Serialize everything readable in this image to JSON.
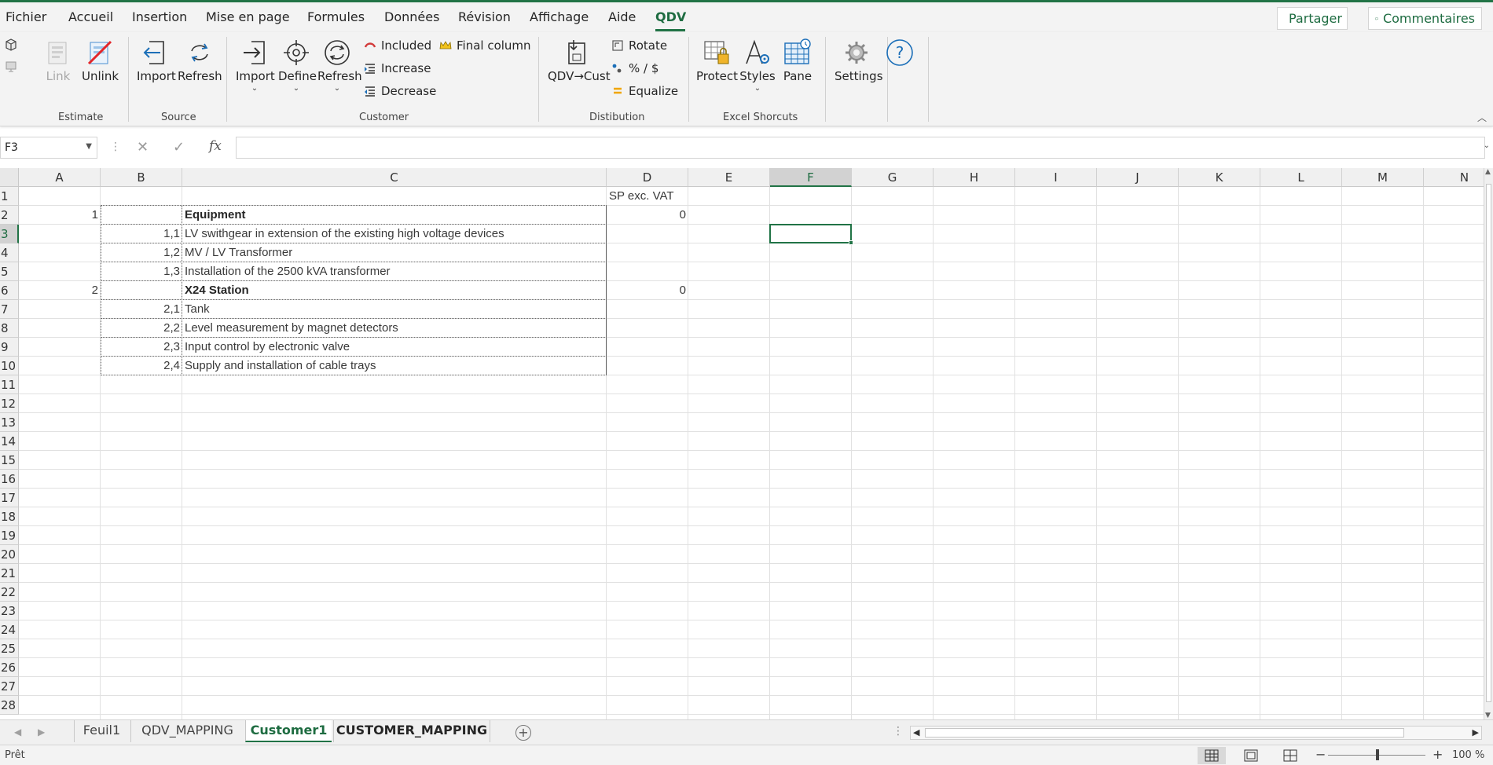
{
  "menu": {
    "items": [
      "Fichier",
      "Accueil",
      "Insertion",
      "Mise en page",
      "Formules",
      "Données",
      "Révision",
      "Affichage",
      "Aide",
      "QDV"
    ],
    "active": "QDV",
    "share_label": "Partager",
    "comments_label": "Commentaires"
  },
  "ribbon": {
    "estimate": {
      "label": "Estimate",
      "link": "Link",
      "unlink": "Unlink"
    },
    "source": {
      "label": "Source",
      "import": "Import",
      "refresh": "Refresh"
    },
    "customer": {
      "label": "Customer",
      "import": "Import",
      "define": "Define",
      "refresh": "Refresh",
      "included": "Included",
      "increase": "Increase",
      "decrease": "Decrease",
      "final_column": "Final column"
    },
    "distibution": {
      "label": "Distibution",
      "qdv_cust": "QDV→Cust",
      "rotate": "Rotate",
      "percent_dollar": "% / $",
      "equalize": "Equalize"
    },
    "excel": {
      "label": "Excel Shorcuts",
      "protect": "Protect",
      "styles": "Styles",
      "pane": "Pane"
    },
    "settings": {
      "label": "Settings"
    }
  },
  "formula_bar": {
    "name_box": "F3",
    "formula": ""
  },
  "columns": [
    "A",
    "B",
    "C",
    "D",
    "E",
    "F",
    "G",
    "H",
    "I",
    "J",
    "K",
    "L",
    "M",
    "N"
  ],
  "selected_column": "F",
  "rows": [
    "1",
    "2",
    "3",
    "4",
    "5",
    "6",
    "7",
    "8",
    "9",
    "10",
    "11",
    "12",
    "13",
    "14",
    "15",
    "16",
    "17",
    "18",
    "19",
    "20",
    "21",
    "22",
    "23",
    "24",
    "25",
    "26",
    "27",
    "28"
  ],
  "selected_row": "3",
  "cells": {
    "D1": "SP exc. VAT",
    "A2": "1",
    "C2": "Equipment",
    "D2": "0",
    "B3": "1,1",
    "C3": "LV swithgear in extension of the existing high voltage devices",
    "B4": "1,2",
    "C4": "MV / LV Transformer",
    "B5": "1,3",
    "C5": "Installation of the 2500 kVA transformer",
    "A6": "2",
    "C6": "X24 Station",
    "D6": "0",
    "B7": "2,1",
    "C7": "Tank",
    "B8": "2,2",
    "C8": "Level measurement by magnet detectors",
    "B9": "2,3",
    "C9": "Input control by electronic valve",
    "B10": "2,4",
    "C10": "Supply and installation of cable trays"
  },
  "sheets": {
    "tabs": [
      "Feuil1",
      "QDV_MAPPING",
      "Customer1",
      "CUSTOMER_MAPPING"
    ],
    "active": "Customer1"
  },
  "status": {
    "text": "Prêt",
    "zoom": "100 %"
  },
  "colors": {
    "accent": "#217346",
    "active_text": "#1e6c41"
  }
}
